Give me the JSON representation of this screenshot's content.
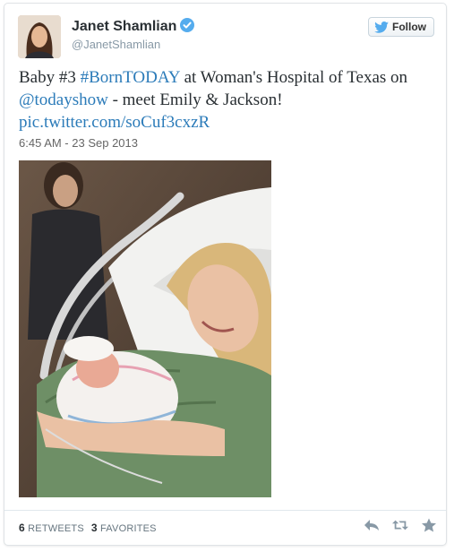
{
  "user": {
    "display_name": "Janet Shamlian",
    "handle": "@JanetShamlian",
    "verified": true
  },
  "follow_button": {
    "label": "Follow"
  },
  "tweet": {
    "text_parts": [
      {
        "text": "Baby #3 ",
        "link": false
      },
      {
        "text": "#BornTODAY",
        "link": true
      },
      {
        "text": " at Woman's Hospital of Texas on ",
        "link": false
      },
      {
        "text": "@todayshow",
        "link": true
      },
      {
        "text": " - meet Emily & Jackson! ",
        "link": false
      },
      {
        "text": "pic.twitter.com/soCuf3cxzR",
        "link": true
      }
    ],
    "timestamp": "6:45 AM - 23 Sep 2013"
  },
  "stats": {
    "retweets_count": "6",
    "retweets_label": "RETWEETS",
    "favorites_count": "3",
    "favorites_label": "FAVORITES"
  },
  "icons": {
    "reply": "reply-icon",
    "retweet": "retweet-icon",
    "favorite": "star-icon"
  },
  "colors": {
    "link": "#2b7bb9",
    "verified": "#55acee",
    "action_icon": "#8899a6"
  }
}
